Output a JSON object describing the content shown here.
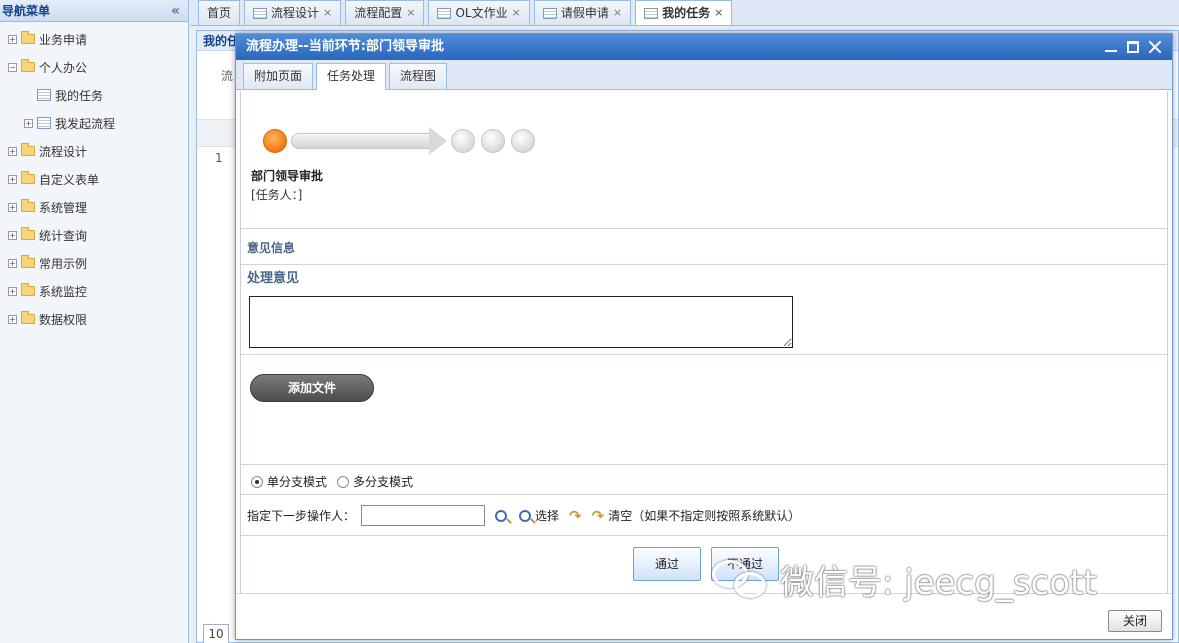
{
  "sidebar": {
    "title": "导航菜单",
    "collapse_glyph": "«",
    "items": [
      {
        "label": "业务申请",
        "level": 0,
        "icon": "folder-icon",
        "expander": "+"
      },
      {
        "label": "个人办公",
        "level": 0,
        "icon": "folder-icon",
        "expander": "−"
      },
      {
        "label": "我的任务",
        "level": 1,
        "icon": "grid-icon",
        "expander": ""
      },
      {
        "label": "我发起流程",
        "level": 1,
        "icon": "grid-icon",
        "expander": "+"
      },
      {
        "label": "流程设计",
        "level": 0,
        "icon": "folder-icon",
        "expander": "+"
      },
      {
        "label": "自定义表单",
        "level": 0,
        "icon": "folder-icon",
        "expander": "+"
      },
      {
        "label": "系统管理",
        "level": 0,
        "icon": "folder-icon",
        "expander": "+"
      },
      {
        "label": "统计查询",
        "level": 0,
        "icon": "folder-icon",
        "expander": "+"
      },
      {
        "label": "常用示例",
        "level": 0,
        "icon": "folder-icon",
        "expander": "+"
      },
      {
        "label": "系统监控",
        "level": 0,
        "icon": "folder-icon",
        "expander": "+"
      },
      {
        "label": "数据权限",
        "level": 0,
        "icon": "folder-icon",
        "expander": "+"
      }
    ]
  },
  "tabs": [
    {
      "label": "首页",
      "icon": "",
      "closable": false
    },
    {
      "label": "流程设计",
      "icon": "grid-icon",
      "closable": true
    },
    {
      "label": "流程配置",
      "icon": "",
      "closable": true
    },
    {
      "label": "OL文作业",
      "icon": "grid-icon",
      "closable": true
    },
    {
      "label": "请假申请",
      "icon": "grid-icon",
      "closable": true
    },
    {
      "label": "我的任务",
      "icon": "grid-icon",
      "closable": true
    }
  ],
  "background_panel": {
    "title": "我的任",
    "sub_label": "流",
    "row_number": "1",
    "page_size": "10"
  },
  "dialog": {
    "title": "流程办理--当前环节:部门领导审批",
    "tabs": [
      "附加页面",
      "任务处理",
      "流程图"
    ],
    "active_tab": 1,
    "current_step": "部门领导审批",
    "assignee_line": "[任务人：]",
    "opinion_section": "意见信息",
    "opinion_label": "处理意见",
    "opinion_value": "",
    "add_file_label": "添加文件",
    "radio_single": "单分支模式",
    "radio_multi": "多分支模式",
    "next_operator_label": "指定下一步操作人：",
    "next_operator_value": "",
    "select_label": "选择",
    "clear_label": "清空（如果不指定则按照系统默认）",
    "pass_label": "通过",
    "reject_label": "不通过",
    "close_label": "关闭"
  },
  "watermark": {
    "text": "微信号: jeecg_scott"
  },
  "colors": {
    "title_bar": "#2a66bb",
    "current_step_dot": "#f07a10",
    "button_border": "#6fa1d9"
  }
}
